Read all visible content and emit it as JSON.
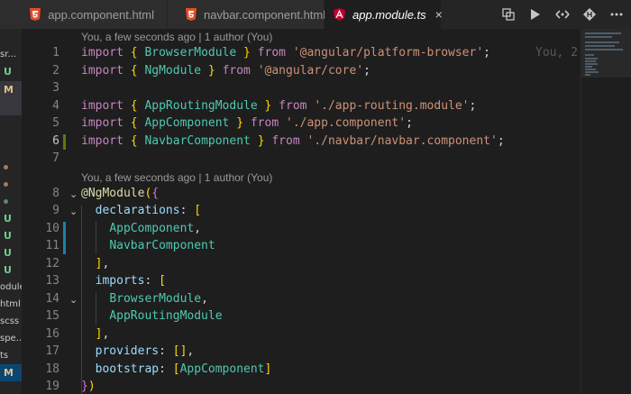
{
  "tabs": [
    {
      "label": "app.component.html",
      "icon": "html5-icon",
      "color": "#e44d26"
    },
    {
      "label": "navbar.component.html",
      "icon": "html5-icon",
      "color": "#e44d26"
    },
    {
      "label": "app.module.ts",
      "icon": "angular-icon",
      "color": "#c3002f",
      "close": "×"
    }
  ],
  "sidebar": {
    "rows": [
      {
        "text": "sr..."
      },
      {
        "badge": "U",
        "color": "#73c991"
      },
      {
        "badge": "M",
        "color": "#e2c08d",
        "selected": true
      },
      {
        "text": ""
      },
      {
        "text": ""
      },
      {
        "text": ""
      },
      {
        "text": ""
      },
      {
        "dot": true,
        "color": "#a57b59"
      },
      {
        "dot": true,
        "color": "#a57b59"
      },
      {
        "dot": true,
        "color": "#5a8a6a"
      },
      {
        "badge": "U",
        "color": "#73c991"
      },
      {
        "badge": "U",
        "color": "#73c991"
      },
      {
        "badge": "U",
        "color": "#73c991"
      },
      {
        "badge": "U",
        "color": "#73c991"
      },
      {
        "text": "odule..."
      },
      {
        "text": "html"
      },
      {
        "text": "scss"
      },
      {
        "text": "spe..."
      },
      {
        "text": "ts"
      },
      {
        "badge": "M",
        "color": "#e2c08d",
        "blue": true
      }
    ]
  },
  "editor": {
    "lens_top": "You, a few seconds ago | 1 author (You)",
    "lens_mid": "You, a few seconds ago | 1 author (You)",
    "ghost_text": "You, 2",
    "line_numbers": [
      "1",
      "2",
      "3",
      "4",
      "5",
      "6",
      "7",
      "8",
      "9",
      "10",
      "11",
      "12",
      "13",
      "14",
      "15",
      "16",
      "17",
      "18",
      "19"
    ],
    "tokens": {
      "import": "import",
      "from": "from",
      "lbrace": "{",
      "rbrace": "}",
      "semi": ";",
      "browser_module": "BrowserModule",
      "ng_module": "NgModule",
      "platform_browser": "'@angular/platform-browser'",
      "angular_core": "'@angular/core'",
      "app_routing_module": "AppRoutingModule",
      "app_routing_path": "'./app-routing.module'",
      "app_component": "AppComponent",
      "app_component_path": "'./app.component'",
      "navbar_component": "NavbarComponent",
      "navbar_path": "'./navbar/navbar.component'",
      "decorator": "@NgModule",
      "lparen": "(",
      "rparen": ")",
      "declarations": "declarations",
      "imports": "imports",
      "providers": "providers",
      "bootstrap": "bootstrap",
      "colon": ":",
      "lbracket": "[",
      "rbracket": "]",
      "comma": ",",
      "empty_array": "[]"
    }
  },
  "colors": {
    "keyword": "#c586c0",
    "string": "#ce9178",
    "type": "#4ec9b0",
    "added_gutter": "#587c0c",
    "modified_gutter": "#1b81a8"
  }
}
